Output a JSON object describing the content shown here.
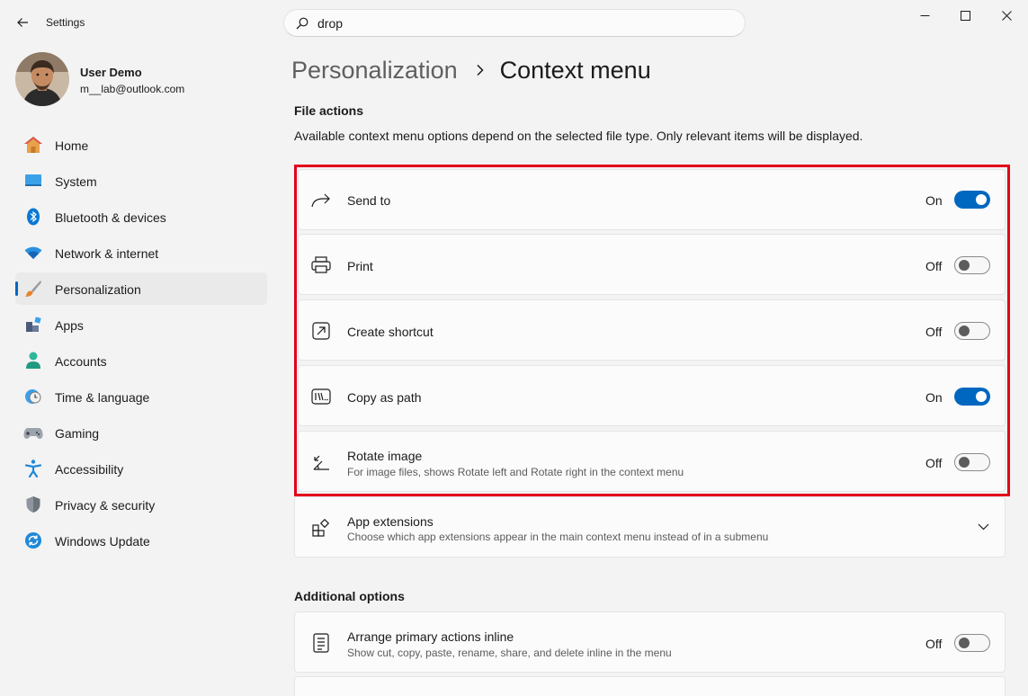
{
  "window": {
    "app_title": "Settings",
    "controls": [
      "minimize-icon",
      "maximize-icon",
      "close-icon"
    ]
  },
  "search": {
    "value": "drop",
    "icon": "search-icon"
  },
  "user": {
    "name": "User Demo",
    "email": "m__lab@outlook.com"
  },
  "sidebar": {
    "items": [
      {
        "label": "Home",
        "icon": "home-icon"
      },
      {
        "label": "System",
        "icon": "system-icon"
      },
      {
        "label": "Bluetooth & devices",
        "icon": "bluetooth-icon"
      },
      {
        "label": "Network & internet",
        "icon": "wifi-icon"
      },
      {
        "label": "Personalization",
        "icon": "brush-icon",
        "selected": true
      },
      {
        "label": "Apps",
        "icon": "apps-icon"
      },
      {
        "label": "Accounts",
        "icon": "accounts-icon"
      },
      {
        "label": "Time & language",
        "icon": "clock-globe-icon"
      },
      {
        "label": "Gaming",
        "icon": "gamepad-icon"
      },
      {
        "label": "Accessibility",
        "icon": "accessibility-icon"
      },
      {
        "label": "Privacy & security",
        "icon": "shield-icon"
      },
      {
        "label": "Windows Update",
        "icon": "update-icon"
      }
    ]
  },
  "breadcrumb": {
    "parent": "Personalization",
    "current": "Context menu"
  },
  "file_actions": {
    "title": "File actions",
    "description": "Available context menu options depend on the selected file type. Only relevant items will be displayed.",
    "items": [
      {
        "label": "Send to",
        "state": "On",
        "on": true,
        "icon": "share-arrow-icon"
      },
      {
        "label": "Print",
        "state": "Off",
        "on": false,
        "icon": "printer-icon"
      },
      {
        "label": "Create shortcut",
        "state": "Off",
        "on": false,
        "icon": "shortcut-icon"
      },
      {
        "label": "Copy as path",
        "state": "On",
        "on": true,
        "icon": "copy-path-icon"
      },
      {
        "label": "Rotate image",
        "sub": "For image files, shows Rotate left and Rotate right in the context menu",
        "state": "Off",
        "on": false,
        "icon": "rotate-icon"
      }
    ]
  },
  "app_extensions": {
    "label": "App extensions",
    "sub": "Choose which app extensions appear in the main context menu instead of in a submenu",
    "icon": "app-extensions-icon"
  },
  "additional_options": {
    "title": "Additional options",
    "items": [
      {
        "label": "Arrange primary actions inline",
        "sub": "Show cut, copy, paste, rename, share, and delete inline in the menu",
        "state": "Off",
        "on": false,
        "icon": "list-icon"
      }
    ]
  },
  "colors": {
    "accent": "#0067c0",
    "highlight": "#e3001b",
    "background": "#f3f3f3"
  }
}
